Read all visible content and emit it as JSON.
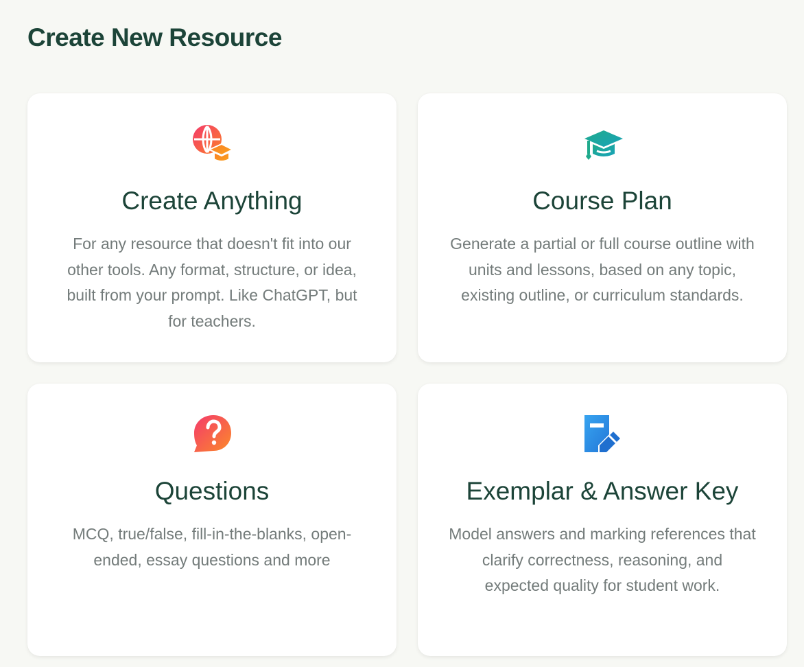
{
  "page": {
    "title": "Create New Resource"
  },
  "cards": [
    {
      "title": "Create Anything",
      "description": "For any resource that doesn't fit into our other tools. Any format, structure, or idea, built from your prompt. Like ChatGPT, but for teachers.",
      "icon": "globe-graduation-cap-icon"
    },
    {
      "title": "Course Plan",
      "description": "Generate a partial or full course outline with units and lessons, based on any topic, existing outline, or curriculum standards.",
      "icon": "graduation-cap-icon"
    },
    {
      "title": "Questions",
      "description": "MCQ, true/false, fill-in-the-blanks, open-ended, essay questions and more",
      "icon": "question-bubble-icon"
    },
    {
      "title": "Exemplar & Answer Key",
      "description": "Model answers and marking references that clarify correctness, reasoning, and expected quality for student work.",
      "icon": "document-edit-icon"
    }
  ],
  "colors": {
    "background": "#f7f8f4",
    "heading": "#1c4438",
    "description": "#737b7a",
    "card": "#ffffff"
  }
}
